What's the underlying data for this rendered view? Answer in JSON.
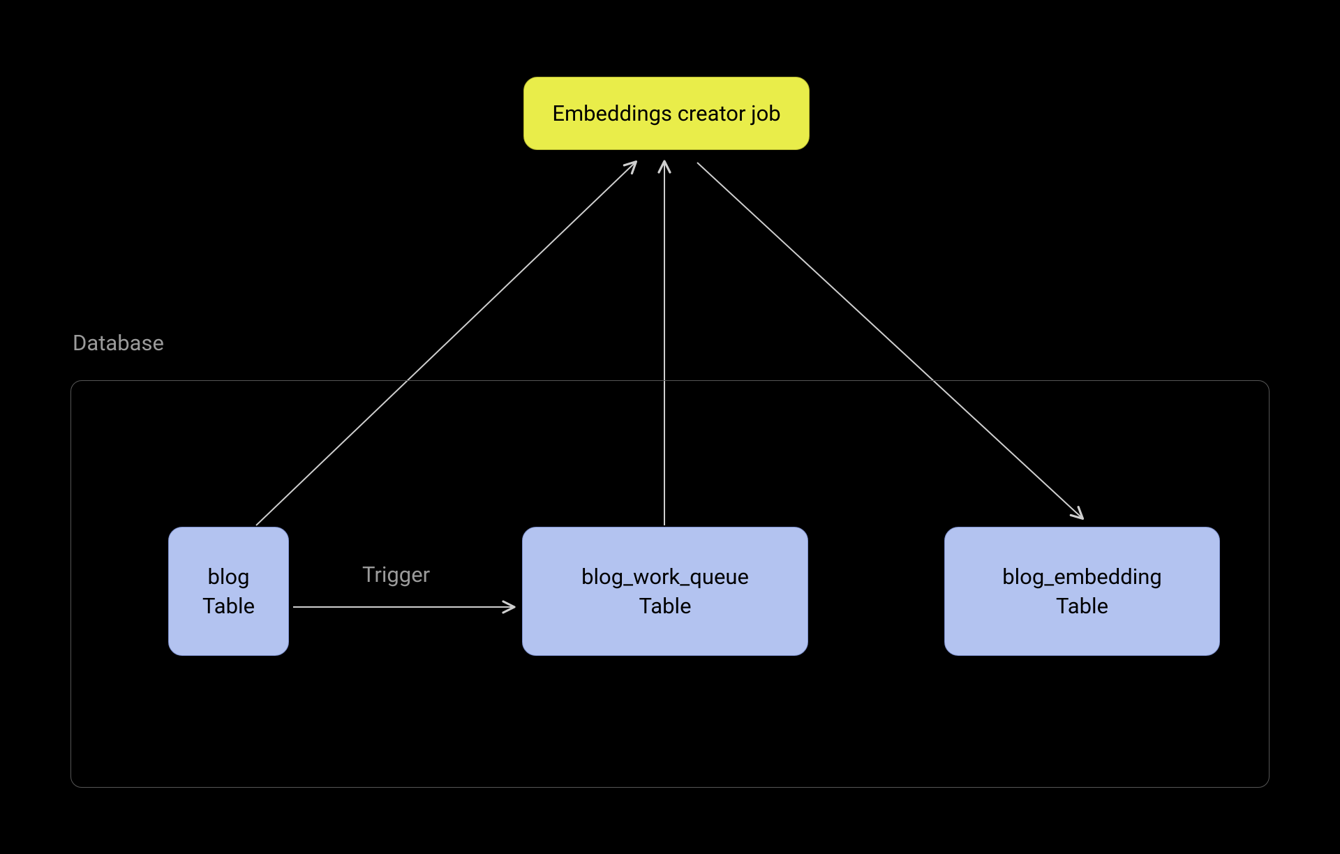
{
  "job": {
    "label": "Embeddings creator job"
  },
  "database": {
    "label": "Database",
    "tables": {
      "blog": {
        "name": "blog",
        "kind": "Table"
      },
      "work_queue": {
        "name": "blog_work_queue",
        "kind": "Table"
      },
      "embedding": {
        "name": "blog_embedding",
        "kind": "Table"
      }
    }
  },
  "edges": {
    "trigger": {
      "label": "Trigger"
    }
  },
  "colors": {
    "background": "#000000",
    "job_bg": "#e9ed4a",
    "table_bg": "#b3c3f0",
    "db_border": "#565656",
    "label_gray": "#9b9b9b",
    "arrow": "#cfcfcf"
  }
}
